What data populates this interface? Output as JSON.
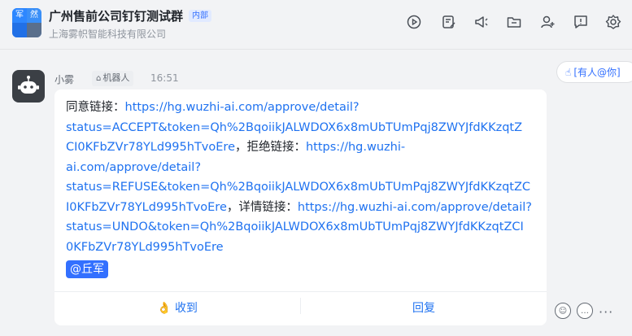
{
  "header": {
    "group_name": "广州售前公司钉钉测试群",
    "internal_badge": "内部",
    "org_name": "上海雾帜智能科技有限公司",
    "avatar_chars": [
      "军",
      "然",
      "",
      ""
    ],
    "toolbar_icons": [
      "history-icon",
      "notes-icon",
      "announcement-icon",
      "folder-icon",
      "add-member-icon",
      "todo-icon",
      "settings-icon"
    ]
  },
  "message": {
    "sender": "小雾",
    "bot_tag": "机器人",
    "time": "16:51",
    "mention_pill": "[有人@你]",
    "segments": {
      "approve_label": "同意链接：",
      "approve_url_1": "https://hg.wuzhi-ai.com/approve/detail?",
      "approve_url_2": "status=ACCEPT&token=Qh%2BqoiikJALWDOX6x8mUbTUmPqj8ZWYJfdKKzqtZ",
      "approve_url_3": "CI0KFbZVr78YLd995hTvoEre",
      "reject_label": "，拒绝链接：",
      "reject_url_1": "https://hg.wuzhi-",
      "reject_url_2": "ai.com/approve/detail?",
      "reject_url_3": "status=REFUSE&token=Qh%2BqoiikJALWDOX6x8mUbTUmPqj8ZWYJfdKKzqtZC",
      "reject_url_4": "I0KFbZVr78YLd995hTvoEre",
      "detail_label": "，详情链接：",
      "detail_url_1": "https://hg.wuzhi-ai.com/approve/detail?",
      "detail_url_2": "status=UNDO&token=Qh%2BqoiikJALWDOX6x8mUbTUmPqj8ZWYJfdKKzqtZCI",
      "detail_url_3": "0KFbZVr78YLd995hTvoEre"
    },
    "mention": "@丘军",
    "received_button": "收到",
    "reply_button": "回复"
  },
  "colors": {
    "accent": "#3370ff",
    "link": "#1f72f0",
    "background": "#f2f3f5"
  }
}
